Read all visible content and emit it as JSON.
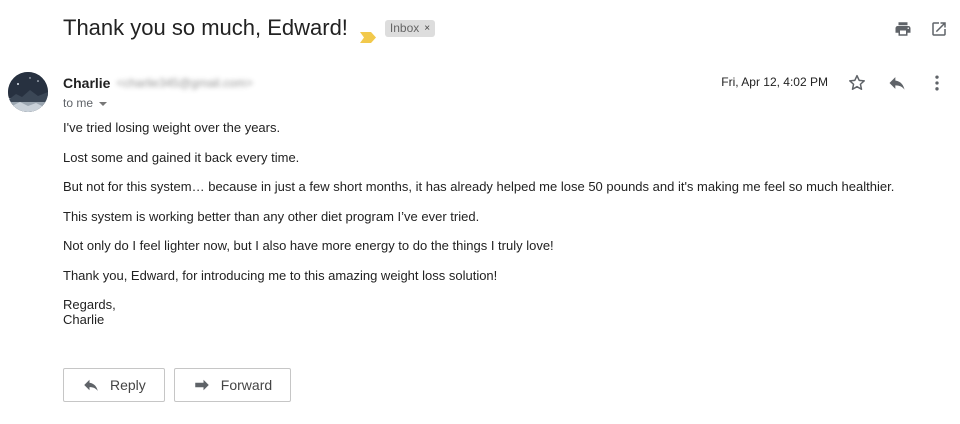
{
  "email": {
    "subject": "Thank you so much, Edward!",
    "label": "Inbox",
    "label_remove": "×",
    "sender_name": "Charlie",
    "sender_email": "<charlie345@gmail.com>",
    "to": "to me",
    "date": "Fri, Apr 12, 4:02 PM",
    "body": [
      "I've tried losing weight over the years.",
      "Lost some and gained it back every time.",
      "But not for this system… because in just a few short months, it has already helped me lose 50 pounds and it's making me feel so much healthier.",
      "This system is working better than any other diet program I’ve ever tried.",
      "Not only do I feel lighter now, but I also have more energy to do the things I truly love!",
      "Thank you, Edward, for introducing me to this amazing weight loss solution!"
    ],
    "signoff": "Regards,",
    "signature": "Charlie"
  },
  "actions": {
    "reply_label": "Reply",
    "forward_label": "Forward"
  },
  "icons": {
    "importance": "importance-marker-icon",
    "print": "print-icon",
    "open_new_window": "open-in-new-icon",
    "star": "star-icon",
    "reply": "reply-icon",
    "more": "more-vert-icon"
  },
  "colors": {
    "importance_marker": "#f2c94c",
    "label_bg": "#dddddd",
    "icon": "#5f6368"
  }
}
